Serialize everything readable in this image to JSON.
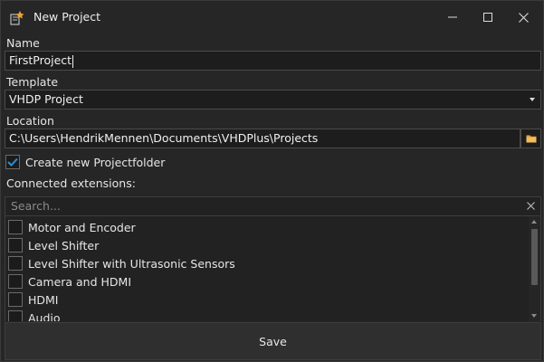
{
  "window": {
    "title": "New Project",
    "icon": "vhdp-app-icon",
    "controls": [
      "minimize-icon",
      "maximize-icon",
      "close-icon"
    ]
  },
  "form": {
    "name_label": "Name",
    "name_value": "FirstProject",
    "template_label": "Template",
    "template_value": "VHDP Project",
    "location_label": "Location",
    "location_value": "C:\\Users\\HendrikMennen\\Documents\\VHDPlus\\Projects",
    "create_folder_label": "Create new Projectfolder",
    "create_folder_checked": true,
    "extensions_label": "Connected extensions:",
    "search_placeholder": "Search..."
  },
  "extensions": [
    {
      "label": "Motor and Encoder",
      "checked": false
    },
    {
      "label": "Level Shifter",
      "checked": false
    },
    {
      "label": "Level Shifter with Ultrasonic Sensors",
      "checked": false
    },
    {
      "label": "Camera and HDMI",
      "checked": false
    },
    {
      "label": "HDMI",
      "checked": false
    },
    {
      "label": "Audio",
      "checked": false
    }
  ],
  "actions": {
    "save_label": "Save"
  },
  "colors": {
    "background": "#262626",
    "field_bg": "#1d1d1d",
    "check_accent": "#2a8fd6",
    "folder_icon": "#e8a33a"
  }
}
